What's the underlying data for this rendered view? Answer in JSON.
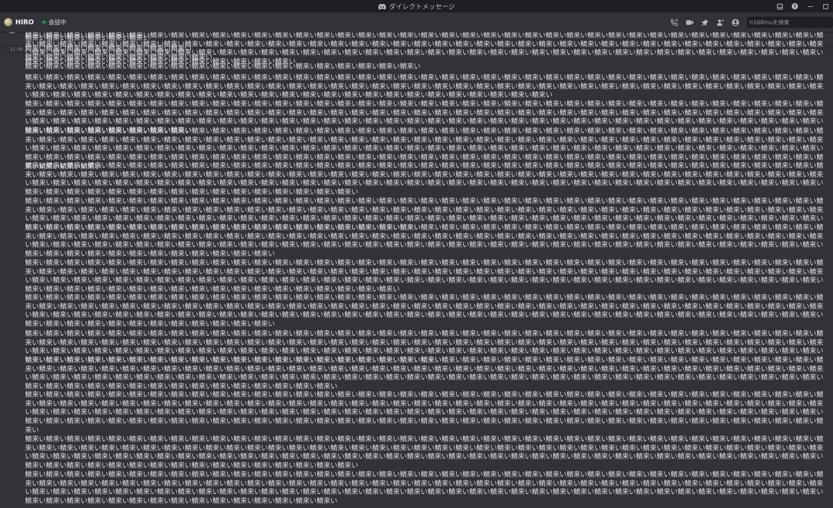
{
  "window": {
    "title": "ダイレクトメッセージ",
    "controls": [
      "inbox-icon",
      "help-icon",
      "minimize-icon",
      "maximize-icon"
    ]
  },
  "header": {
    "username": "HIRO",
    "call_status": "会話中",
    "search_placeholder": "h168muを検索",
    "tools": [
      "phone-icon",
      "video-icon",
      "pin-icon",
      "add-friend-icon",
      "profile-icon"
    ]
  },
  "messages": [
    {
      "timestamp": "",
      "text": "鯖来い鯖来い鯖来い鯖来い鯖来い鯖来い",
      "highlight": false
    },
    {
      "timestamp": "21:39",
      "text": "鯖来い鯖来い鯖来い鯖来い鯖来い鯖来い鯖来い鯖来い",
      "highlight": true
    },
    {
      "timestamp": "",
      "text": "鯖来い鯖来い鯖来い鯖来い鯖来い鯖来い鯖来い鯖来い鯖来い",
      "highlight": false
    },
    {
      "timestamp": "",
      "text": "鯖来い鯖来い鯖来い鯖来い鯖来い鯖来い鯖来い鯖来い鯖来い鯖来い鯖来い鯖来い鯖来い鯖来い鯖来い鯖来い鯖来い鯖来い鯖来い",
      "highlight": false
    },
    {
      "timestamp": "",
      "text": "鯖来い鯖来い鯖来い鯖来い鯖来い鯖来い鯖来い鯖来い鯖来い鯖来い鯖来い鯖来い鯖来い鯖来い鯖来い鯖来い鯖来い鯖来い鯖来い鯖来い鯖来い鯖来い鯖来い鯖来い鯖来い鯖来い鯖来い鯖来い鯖来い鯖来い鯖来い鯖来い鯖来い鯖来い鯖来い鯖来い鯖来い鯖来い鯖来い鯖来い鯖来い鯖来い鯖来い鯖来い鯖来い鯖来い鯖来い鯖来い鯖来い鯖来い鯖来い鯖来い鯖来い鯖来い鯖来い鯖来い鯖来い鯖来い鯖来い鯖来い鯖来い鯖来い鯖来い鯖来い鯖来い鯖来い鯖来い鯖来い鯖来い鯖来い鯖来い鯖来い鯖来い鯖来い鯖来い鯖来い鯖来い鯖来い鯖来い鯖来い鯖来い鯖来い鯖来い鯖来い鯖来い鯖来い鯖来い鯖来い鯖来い鯖来い鯖来い鯖来い鯖来い鯖来い鯖来い鯖来い鯖来い鯖来い鯖来い鯖来い鯖来い鯖来い",
      "highlight": false
    },
    {
      "timestamp": "",
      "text": "鯖来い鯖来い鯖来い鯖来い鯖来い鯖来い鯖来い鯖来い鯖来い鯖来い鯖来い鯖来い鯖来い鯖来い鯖来い鯖来い鯖来い鯖来い鯖来い鯖来い鯖来い鯖来い鯖来い鯖来い鯖来い鯖来い鯖来い鯖来い鯖来い鯖来い鯖来い鯖来い鯖来い鯖来い鯖来い鯖来い鯖来い鯖来い鯖来い鯖来い鯖来い鯖来い鯖来い鯖来い鯖来い鯖来い鯖来い鯖来い鯖来い鯖来い鯖来い鯖来い鯖来い鯖来い鯖来い鯖来い鯖来い鯖来い鯖来い鯖来い鯖来い鯖来い鯖来い鯖来い鯖来い鯖来い鯖来い鯖来い鯖来い鯖来い鯖来い鯖来い鯖来い鯖来い鯖来い鯖来い鯖来い鯖来い鯖来い鯖来い鯖来い鯖来い鯖来い鯖来い鯖来い鯖来い鯖来い鯖来い鯖来い鯖来い鯖来い鯖来い鯖来い鯖来い鯖来い鯖来い鯖来い鯖来い鯖来い鯖来い鯖来い鯖来い鯖来い鯖来い鯖来い鯖来い鯖来い鯖来い鯖来い鯖来い鯖来い鯖来い鯖来い鯖来い鯖来い鯖来い鯖来い鯖来い鯖来い鯖来い鯖来い鯖来い鯖来い",
      "highlight": false
    },
    {
      "timestamp": "",
      "text": "鯖来い鯖来い鯖来い鯖来い鯖来い鯖来い鯖来い鯖来い鯖来い鯖来い鯖来い鯖来い鯖来い鯖来い鯖来い鯖来い鯖来い鯖来い鯖来い鯖来い鯖来い鯖来い鯖来い鯖来い鯖来い鯖来い鯖来い鯖来い鯖来い鯖来い鯖来い鯖来い鯖来い鯖来い鯖来い鯖来い鯖来い鯖来い鯖来い鯖来い鯖来い鯖来い鯖来い鯖来い鯖来い鯖来い鯖来い鯖来い鯖来い鯖来い鯖来い鯖来い鯖来い鯖来い鯖来い鯖来い鯖来い鯖来い鯖来い鯖来い鯖来い鯖来い鯖来い鯖来い鯖来い鯖来い鯖来い鯖来い鯖来い鯖来い鯖来い鯖来い鯖来い鯖来い鯖来い鯖来い鯖来い鯖来い鯖来い鯖来い鯖来い鯖来い鯖来い鯖来い鯖来い鯖来い鯖来い鯖来い鯖来い鯖来い鯖来い鯖来い鯖来い鯖来い鯖来い鯖来い鯖来い鯖来い鯖来い鯖来い鯖来い鯖来い鯖来い鯖来い鯖来い鯖来い鯖来い鯖来い鯖来い鯖来い鯖来い鯖来い鯖来い鯖来い鯖来い鯖来い鯖来い鯖来い鯖来い鯖来い鯖来い鯖来い鯖来い鯖来い鯖来い鯖来い鯖来い鯖来い鯖来い鯖来い鯖来い鯖来い鯖来い鯖来い鯖来い鯖来い鯖来い鯖来い鯖来い鯖来い鯖来い鯖来い鯖来い鯖来い鯖来い鯖来い鯖来い鯖来い鯖来い鯖来い鯖来い鯖来い鯖来い鯖来い鯖来い鯖来い鯖来い",
      "highlight": false
    },
    {
      "timestamp": "",
      "text": "鯖来い鯖来い鯖来い鯖来い鯖来い鯖来い鯖来い鯖来い鯖来い鯖来い鯖来い鯖来い鯖来い鯖来い鯖来い鯖来い鯖来い鯖来い鯖来い鯖来い鯖来い鯖来い鯖来い鯖来い鯖来い鯖来い鯖来い鯖来い鯖来い鯖来い鯖来い鯖来い鯖来い鯖来い鯖来い鯖来い鯖来い鯖来い鯖来い鯖来い鯖来い鯖来い鯖来い鯖来い鯖来い鯖来い鯖来い鯖来い鯖来い鯖来い鯖来い鯖来い鯖来い鯖来い鯖来い鯖来い鯖来い鯖来い鯖来い鯖来い鯖来い鯖来い鯖来い鯖来い鯖来い鯖来い鯖来い鯖来い鯖来い鯖来い鯖来い鯖来い鯖来い鯖来い鯖来い鯖来い鯖来い鯖来い鯖来い鯖来い鯖来い鯖来い鯖来い鯖来い鯖来い鯖来い鯖来い鯖来い鯖来い鯖来い鯖来い鯖来い鯖来い鯖来い鯖来い鯖来い鯖来い鯖来い鯖来い鯖来い鯖来い鯖来い鯖来い鯖来い鯖来い鯖来い鯖来い鯖来い鯖来い鯖来い鯖来い鯖来い鯖来い鯖来い鯖来い鯖来い鯖来い鯖来い鯖来い鯖来い鯖来い鯖来い鯖来い鯖来い鯖来い鯖来い鯖来い鯖来い鯖来い鯖来い鯖来い",
      "highlight": false
    },
    {
      "timestamp": "",
      "text": "鯖来い鯖来い鯖来い鯖来い鯖来い鯖来い鯖来い鯖来い鯖来い鯖来い鯖来い鯖来い鯖来い鯖来い鯖来い鯖来い鯖来い鯖来い鯖来い鯖来い鯖来い鯖来い鯖来い鯖来い鯖来い鯖来い鯖来い鯖来い鯖来い鯖来い鯖来い鯖来い鯖来い鯖来い鯖来い鯖来い鯖来い鯖来い鯖来い鯖来い鯖来い鯖来い鯖来い鯖来い鯖来い鯖来い鯖来い鯖来い鯖来い鯖来い鯖来い鯖来い鯖来い鯖来い鯖来い鯖来い鯖来い鯖来い鯖来い鯖来い鯖来い鯖来い鯖来い鯖来い鯖来い鯖来い鯖来い鯖来い鯖来い鯖来い鯖来い鯖来い鯖来い鯖来い鯖来い鯖来い鯖来い鯖来い鯖来い鯖来い鯖来い鯖来い鯖来い鯖来い鯖来い鯖来い鯖来い鯖来い鯖来い鯖来い鯖来い鯖来い鯖来い鯖来い鯖来い鯖来い鯖来い鯖来い鯖来い鯖来い鯖来い鯖来い鯖来い鯖来い鯖来い鯖来い鯖来い鯖来い鯖来い鯖来い鯖来い鯖来い鯖来い鯖来い鯖来い鯖来い鯖来い鯖来い鯖来い鯖来い鯖来い鯖来い鯖来い鯖来い鯖来い鯖来い鯖来い鯖来い鯖来い鯖来い鯖来い鯖来い鯖来い鯖来い",
      "highlight": false
    },
    {
      "timestamp": "",
      "text": "鯖来い鯖来い鯖来い鯖来い鯖来い鯖来い鯖来い鯖来い鯖来い鯖来い鯖来い鯖来い鯖来い鯖来い鯖来い鯖来い鯖来い鯖来い鯖来い鯖来い鯖来い鯖来い鯖来い鯖来い鯖来い鯖来い鯖来い鯖来い鯖来い鯖来い鯖来い鯖来い鯖来い鯖来い鯖来い鯖来い鯖来い鯖来い鯖来い鯖来い鯖来い鯖来い鯖来い鯖来い鯖来い鯖来い鯖来い鯖来い鯖来い鯖来い鯖来い鯖来い鯖来い鯖来い鯖来い鯖来い鯖来い鯖来い鯖来い鯖来い鯖来い鯖来い鯖来い鯖来い鯖来い鯖来い鯖来い鯖来い鯖来い鯖来い鯖来い鯖来い鯖来い鯖来い鯖来い鯖来い鯖来い鯖来い鯖来い鯖来い鯖来い鯖来い鯖来い鯖来い鯖来い鯖来い鯖来い鯖来い鯖来い鯖来い鯖来い鯖来い鯖来い鯖来い鯖来い鯖来い鯖来い鯖来い鯖来い鯖来い鯖来い鯖来い鯖来い鯖来い鯖来い鯖来い鯖来い鯖来い鯖来い鯖来い鯖来い鯖来い鯖来い鯖来い鯖来い鯖来い鯖来い鯖来い鯖来い鯖来い鯖来い鯖来い鯖来い鯖来い鯖来い鯖来い鯖来い",
      "highlight": false
    },
    {
      "timestamp": "",
      "text": "鯖来い鯖来い鯖来い鯖来い鯖来い鯖来い鯖来い鯖来い鯖来い鯖来い鯖来い鯖来い鯖来い鯖来い鯖来い鯖来い鯖来い鯖来い鯖来い鯖来い鯖来い鯖来い鯖来い鯖来い鯖来い鯖来い鯖来い鯖来い鯖来い鯖来い鯖来い鯖来い鯖来い鯖来い鯖来い鯖来い鯖来い鯖来い鯖来い鯖来い鯖来い鯖来い鯖来い鯖来い鯖来い鯖来い鯖来い鯖来い鯖来い鯖来い鯖来い鯖来い鯖来い鯖来い鯖来い鯖来い鯖来い鯖来い鯖来い鯖来い鯖来い鯖来い鯖来い鯖来い鯖来い鯖来い鯖来い鯖来い鯖来い鯖来い鯖来い鯖来い鯖来い鯖来い鯖来い鯖来い鯖来い鯖来い鯖来い鯖来い鯖来い鯖来い鯖来い鯖来い鯖来い鯖来い鯖来い鯖来い鯖来い鯖来い鯖来い鯖来い鯖来い鯖来い鯖来い鯖来い鯖来い鯖来い鯖来い鯖来い鯖来い鯖来い鯖来い鯖来い鯖来い鯖来い鯖来い鯖来い鯖来い鯖来い鯖来い鯖来い鯖来い鯖来い鯖来い鯖来い鯖来い鯖来い鯖来い鯖来い鯖来い鯖来い鯖来い鯖来い鯖来い鯖来い鯖来い鯖来い鯖来い鯖来い鯖来い鯖来い鯖来い",
      "highlight": false
    },
    {
      "timestamp": "",
      "text": "鯖来い鯖来い鯖来い鯖来い鯖来い鯖来い鯖来い鯖来い鯖来い鯖来い鯖来い鯖来い鯖来い鯖来い鯖来い鯖来い鯖来い鯖来い鯖来い鯖来い鯖来い鯖来い鯖来い鯖来い鯖来い鯖来い鯖来い鯖来い鯖来い鯖来い鯖来い鯖来い鯖来い鯖来い鯖来い鯖来い鯖来い鯖来い鯖来い鯖来い鯖来い鯖来い鯖来い鯖来い鯖来い鯖来い鯖来い鯖来い鯖来い鯖来い鯖来い鯖来い鯖来い鯖来い鯖来い鯖来い鯖来い鯖来い鯖来い鯖来い鯖来い鯖来い鯖来い鯖来い鯖来い鯖来い鯖来い鯖来い鯖来い鯖来い鯖来い鯖来い鯖来い鯖来い鯖来い鯖来い鯖来い鯖来い鯖来い鯖来い鯖来い鯖来い鯖来い鯖来い鯖来い鯖来い鯖来い鯖来い鯖来い鯖来い鯖来い鯖来い鯖来い鯖来い鯖来い鯖来い鯖来い鯖来い鯖来い鯖来い鯖来い鯖来い鯖来い鯖来い鯖来い鯖来い鯖来い鯖来い鯖来い鯖来い鯖来い鯖来い鯖来い鯖来い鯖来い鯖来い鯖来い鯖来い鯖来い鯖来い鯖来い鯖来い鯖来い鯖来い鯖来い鯖来い鯖来い",
      "highlight": false
    },
    {
      "timestamp": "",
      "text": "鯖来い鯖来い鯖来い鯖来い鯖来い鯖来い鯖来い鯖来い鯖来い鯖来い鯖来い鯖来い鯖来い鯖来い鯖来い鯖来い鯖来い鯖来い鯖来い鯖来い鯖来い鯖来い鯖来い鯖来い鯖来い鯖来い鯖来い鯖来い鯖来い鯖来い鯖来い鯖来い鯖来い鯖来い鯖来い鯖来い鯖来い鯖来い鯖来い鯖来い鯖来い鯖来い鯖来い鯖来い鯖来い鯖来い鯖来い鯖来い鯖来い鯖来い鯖来い鯖来い鯖来い鯖来い鯖来い鯖来い鯖来い鯖来い鯖来い鯖来い鯖来い鯖来い鯖来い鯖来い鯖来い鯖来い鯖来い鯖来い鯖来い鯖来い鯖来い鯖来い鯖来い鯖来い鯖来い鯖来い鯖来い鯖来い鯖来い鯖来い鯖来い鯖来い鯖来い鯖来い鯖来い鯖来い鯖来い鯖来い鯖来い鯖来い鯖来い鯖来い鯖来い鯖来い鯖来い鯖来い鯖来い鯖来い鯖来い鯖来い鯖来い鯖来い鯖来い鯖来い鯖来い鯖来い鯖来い鯖来い鯖来い鯖来い鯖来い鯖来い鯖来い鯖来い鯖来い鯖来い鯖来い鯖来い鯖来い鯖来い鯖来い鯖来い鯖来い鯖来い鯖来い鯖来い鯖来い鯖来い鯖来い鯖来い鯖来い鯖来い鯖来い鯖来い鯖来い",
      "highlight": false
    },
    {
      "timestamp": "",
      "text": "鯖来い鯖来い鯖来い鯖来い鯖来い鯖来い鯖来い鯖来い鯖来い鯖来い鯖来い鯖来い鯖来い鯖来い鯖来い鯖来い鯖来い鯖来い鯖来い鯖来い鯖来い鯖来い鯖来い鯖来い鯖来い鯖来い鯖来い鯖来い鯖来い鯖来い鯖来い鯖来い鯖来い鯖来い鯖来い鯖来い鯖来い鯖来い鯖来い鯖来い鯖来い鯖来い鯖来い鯖来い鯖来い鯖来い鯖来い鯖来い鯖来い鯖来い鯖来い鯖来い鯖来い鯖来い鯖来い鯖来い鯖来い鯖来い鯖来い鯖来い鯖来い鯖来い鯖来い鯖来い鯖来い鯖来い鯖来い鯖来い鯖来い鯖来い鯖来い鯖来い鯖来い鯖来い鯖来い鯖来い鯖来い鯖来い鯖来い鯖来い鯖来い鯖来い鯖来い鯖来い鯖来い鯖来い鯖来い鯖来い鯖来い鯖来い鯖来い鯖来い鯖来い鯖来い鯖来い鯖来い鯖来い鯖来い鯖来い鯖来い鯖来い鯖来い鯖来い鯖来い鯖来い鯖来い鯖来い鯖来い鯖来い鯖来い鯖来い鯖来い鯖来い鯖来い鯖来い鯖来い鯖来い鯖来い鯖来い鯖来い鯖来い鯖来い鯖来い鯖来い鯖来い鯖来い鯖来い鯖来い鯖来い鯖来い",
      "highlight": false
    },
    {
      "timestamp": "",
      "text": "鯖来い鯖来い鯖来い鯖来い鯖来い鯖来い鯖来い鯖来い鯖来い鯖来い鯖来い鯖来い鯖来い鯖来い鯖来い鯖来い鯖来い鯖来い鯖来い鯖来い鯖来い鯖来い鯖来い鯖来い鯖来い鯖来い鯖来い鯖来い鯖来い鯖来い鯖来い鯖来い鯖来い鯖来い鯖来い鯖来い鯖来い鯖来い鯖来い鯖来い鯖来い鯖来い鯖来い鯖来い鯖来い鯖来い鯖来い鯖来い鯖来い鯖来い鯖来い鯖来い鯖来い鯖来い鯖来い鯖来い鯖来い鯖来い鯖来い鯖来い鯖来い鯖来い鯖来い鯖来い鯖来い鯖来い鯖来い鯖来い鯖来い鯖来い鯖来い鯖来い鯖来い鯖来い鯖来い鯖来い鯖来い鯖来い鯖来い鯖来い鯖来い鯖来い鯖来い鯖来い鯖来い鯖来い鯖来い鯖来い鯖来い鯖来い鯖来い鯖来い鯖来い鯖来い鯖来い鯖来い鯖来い鯖来い鯖来い鯖来い鯖来い鯖来い鯖来い鯖来い鯖来い鯖来い鯖来い鯖来い鯖来い鯖来い鯖来い鯖来い鯖来い鯖来い鯖来い鯖来い鯖来い鯖来い鯖来い鯖来い鯖来い鯖来い鯖来い鯖来い鯖来い鯖来い鯖来い鯖来い鯖来い鯖来い鯖来い鯖来い鯖来い鯖来い鯖来い鯖来い鯖来い鯖来い鯖来い鯖来い鯖来い鯖来い鯖来い鯖来い鯖来い鯖来い鯖来い鯖来い鯖来い鯖来い鯖来い鯖来い鯖来い鯖来い",
      "highlight": false
    },
    {
      "timestamp": "",
      "text": "鯖来い鯖来い鯖来い鯖来い鯖来い鯖来い鯖来い鯖来い鯖来い鯖来い鯖来い鯖来い鯖来い鯖来い鯖来い鯖来い鯖来い鯖来い鯖来い鯖来い鯖来い鯖来い鯖来い鯖来い鯖来い鯖来い鯖来い鯖来い鯖来い鯖来い鯖来い鯖来い鯖来い鯖来い鯖来い鯖来い鯖来い鯖来い鯖来い鯖来い鯖来い鯖来い鯖来い鯖来い鯖来い鯖来い鯖来い鯖来い鯖来い鯖来い鯖来い鯖来い鯖来い鯖来い鯖来い鯖来い鯖来い鯖来い鯖来い鯖来い鯖来い鯖来い鯖来い鯖来い鯖来い鯖来い鯖来い鯖来い鯖来い鯖来い鯖来い鯖来い鯖来い鯖来い鯖来い鯖来い鯖来い鯖来い鯖来い鯖来い鯖来い鯖来い鯖来い鯖来い鯖来い鯖来い鯖来い鯖来い鯖来い鯖来い鯖来い鯖来い鯖来い鯖来い鯖来い鯖来い鯖来い鯖来い鯖来い鯖来い鯖来い鯖来い鯖来い鯖来い鯖来い鯖来い鯖来い鯖来い鯖来い鯖来い鯖来い鯖来い鯖来い鯖来い鯖来い鯖来い鯖来い鯖来い鯖来い鯖来い鯖来い鯖来い鯖来い鯖来い鯖来い鯖来い鯖来い鯖来い鯖来い鯖来い鯖来い",
      "highlight": false
    },
    {
      "timestamp": "",
      "text": "鯖来い鯖来い鯖来い鯖来い鯖来い鯖来い鯖来い鯖来い鯖来い鯖来い鯖来い鯖来い鯖来い鯖来い鯖来い鯖来い鯖来い鯖来い鯖来い鯖来い鯖来い鯖来い鯖来い鯖来い鯖来い鯖来い鯖来い鯖来い鯖来い鯖来い鯖来い鯖来い鯖来い鯖来い鯖来い鯖来い鯖来い鯖来い鯖来い鯖来い鯖来い鯖来い鯖来い鯖来い鯖来い鯖来い鯖来い鯖来い鯖来い鯖来い鯖来い鯖来い鯖来い鯖来い鯖来い鯖来い鯖来い鯖来い鯖来い鯖来い鯖来い鯖来い鯖来い鯖来い鯖来い鯖来い鯖来い鯖来い鯖来い鯖来い鯖来い鯖来い鯖来い鯖来い鯖来い鯖来い鯖来い鯖来い鯖来い鯖来い鯖来い鯖来い鯖来い鯖来い鯖来い鯖来い鯖来い鯖来い鯖来い鯖来い鯖来い鯖来い鯖来い鯖来い鯖来い鯖来い鯖来い鯖来い鯖来い鯖来い鯖来い鯖来い鯖来い鯖来い鯖来い鯖来い鯖来い鯖来い鯖来い鯖来い鯖来い鯖来い鯖来い鯖来い鯖来い鯖来い鯖来い鯖来い鯖来い鯖来い鯖来い鯖来い鯖来い鯖来い鯖来い鯖来い鯖来い鯖来い鯖来い鯖来い",
      "highlight": false
    },
    {
      "timestamp": "",
      "text": "鯖来い鯖来い鯖来い鯖来い鯖来い鯖来い鯖来い鯖来い鯖来い鯖来い鯖来い鯖来い鯖来い鯖来い鯖来い鯖来い鯖来い鯖来い鯖来い鯖来い鯖来い鯖来い鯖来い鯖来い鯖来い鯖来い鯖来い鯖来い鯖来い鯖来い鯖来い鯖来い鯖来い鯖来い鯖来い鯖来い鯖来い鯖来い鯖来い鯖来い鯖来い鯖来い鯖来い鯖来い鯖来い鯖来い鯖来い鯖来い鯖来い鯖来い鯖来い鯖来い鯖来い鯖来い鯖来い鯖来い鯖来い鯖来い鯖来い鯖来い鯖来い鯖来い鯖来い鯖来い鯖来い鯖来い鯖来い鯖来い鯖来い鯖来い鯖来い鯖来い鯖来い鯖来い鯖来い鯖来い鯖来い鯖来い鯖来い鯖来い鯖来い鯖来い鯖来い鯖来い鯖来い鯖来い鯖来い鯖来い鯖来い鯖来い鯖来い鯖来い鯖来い鯖来い鯖来い鯖来い鯖来い鯖来い鯖来い鯖来い鯖来い鯖来い鯖来い鯖来い鯖来い鯖来い鯖来い鯖来い鯖来い鯖来い鯖来い鯖来い鯖来い鯖来い鯖来い鯖来い鯖来い鯖来い鯖来い鯖来い鯖来い鯖来い鯖来い鯖来い鯖来い鯖来い鯖来い鯖来い",
      "highlight": false
    }
  ]
}
